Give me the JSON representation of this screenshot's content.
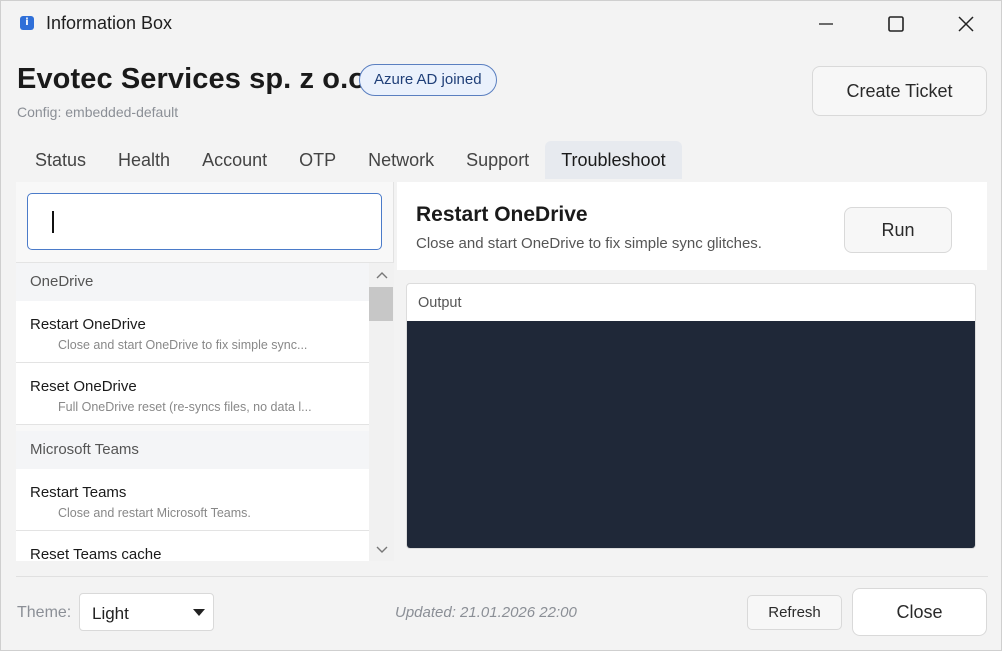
{
  "window": {
    "title": "Information Box",
    "icon": "info-icon"
  },
  "header": {
    "org_name": "Evotec Services sp. z o.o.",
    "badge": "Azure AD joined",
    "config": "Config: embedded-default",
    "create_ticket_label": "Create Ticket"
  },
  "tabs": [
    {
      "label": "Status"
    },
    {
      "label": "Health"
    },
    {
      "label": "Account"
    },
    {
      "label": "OTP"
    },
    {
      "label": "Network"
    },
    {
      "label": "Support"
    },
    {
      "label": "Troubleshoot",
      "active": true
    }
  ],
  "search": {
    "value": "",
    "placeholder": ""
  },
  "actions_list": {
    "groups": [
      {
        "name": "OneDrive",
        "items": [
          {
            "title": "Restart OneDrive",
            "desc": "Close and start OneDrive to fix simple sync..."
          },
          {
            "title": "Reset OneDrive",
            "desc": "Full OneDrive reset (re-syncs files, no data l..."
          }
        ]
      },
      {
        "name": "Microsoft Teams",
        "items": [
          {
            "title": "Restart Teams",
            "desc": "Close and restart Microsoft Teams."
          },
          {
            "title": "Reset Teams cache",
            "desc": ""
          }
        ]
      }
    ],
    "scroll_position": 0.0
  },
  "selected_action": {
    "title": "Restart OneDrive",
    "desc": "Close and start OneDrive to fix simple sync glitches.",
    "run_label": "Run"
  },
  "output": {
    "label": "Output",
    "text": "",
    "console_color": "#1f2838"
  },
  "footer": {
    "theme_label": "Theme:",
    "theme_value": "Light",
    "updated": "Updated: 21.01.2026 22:00",
    "refresh_label": "Refresh",
    "close_label": "Close"
  },
  "colors": {
    "accent": "#4b7bc9",
    "badge_bg": "#eaf1fc",
    "badge_border": "#5a7fc0"
  }
}
